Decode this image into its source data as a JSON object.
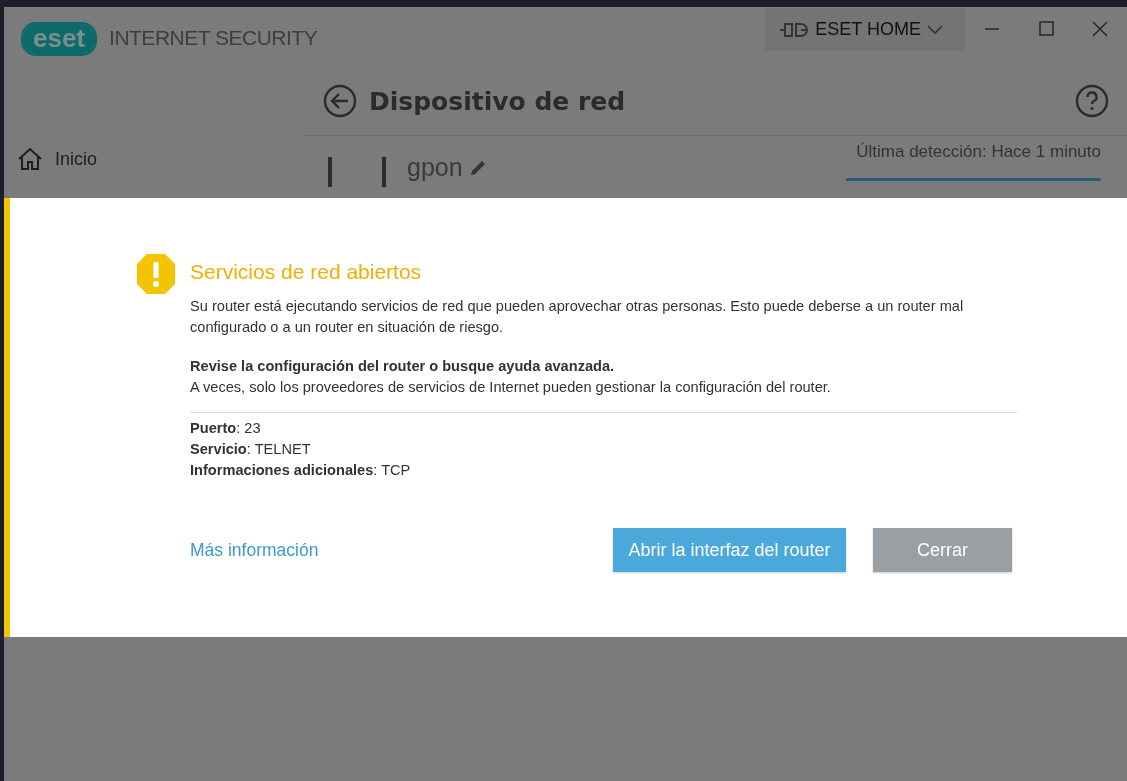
{
  "window": {
    "logo": "eset",
    "product": "INTERNET SECURITY",
    "account_button": "ESET HOME"
  },
  "sidebar": {
    "items": [
      "Inicio"
    ]
  },
  "page": {
    "title": "Dispositivo de red",
    "device_name": "gpon",
    "last_seen": "Última detección: Hace 1 minuto"
  },
  "dialog": {
    "title": "Servicios de red abiertos",
    "message": "Su router está ejecutando servicios de red que pueden aprovechar otras personas. Esto puede deberse a un router mal configurado o a un router en situación de riesgo.",
    "advice_title": "Revise la configuración del router o busque ayuda avanzada.",
    "advice": "A veces, solo los proveedores de servicios de Internet pueden gestionar la configuración del router.",
    "details": [
      "**Puerto**: 23",
      "**Servicio**: TELNET",
      "**Informaciones adicionales**: TCP"
    ],
    "link": "Más información",
    "buttons": [
      {
        "label": "Abrir la interfaz del router",
        "kind": "primary"
      },
      {
        "label": "Cerrar",
        "kind": "secondary"
      }
    ]
  }
}
